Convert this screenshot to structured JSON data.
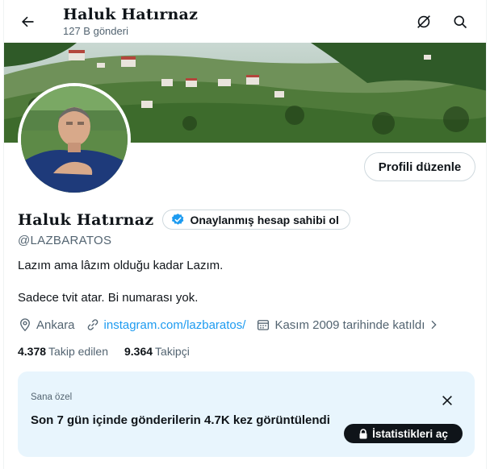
{
  "header": {
    "name": "Haluk Hatırnaz",
    "post_count": "127 B gönderi"
  },
  "profile": {
    "edit_button": "Profili düzenle",
    "display_name": "Haluk Hatırnaz",
    "verified_label": "Onaylanmış hesap sahibi ol",
    "handle": "@LAZBARATOS",
    "bio_line1": "Lazım ama lâzım olduğu kadar Lazım.",
    "bio_line2": "Sadece tvit atar. Bi numarası yok.",
    "location": "Ankara",
    "website": "instagram.com/lazbaratos/",
    "joined": "Kasım 2009 tarihinde katıldı",
    "following_count": "4.378",
    "following_label": "Takip edilen",
    "followers_count": "9.364",
    "followers_label": "Takipçi"
  },
  "card": {
    "small_label": "Sana özel",
    "text": "Son 7 gün içinde gönderilerin 4.7K kez görüntülendi",
    "button": "İstatistikleri aç"
  },
  "icons": {
    "back": "arrow-left-icon",
    "hide": "eye-off-icon",
    "search": "search-icon",
    "verified": "verified-badge-icon",
    "location": "location-pin-icon",
    "link": "link-icon",
    "calendar": "calendar-icon",
    "chevron": "chevron-right-icon",
    "close": "close-icon",
    "lock": "lock-icon"
  },
  "colors": {
    "accent": "#1d9bf0",
    "text": "#0f1419",
    "muted": "#536471",
    "card_bg": "#e8f5fd"
  }
}
